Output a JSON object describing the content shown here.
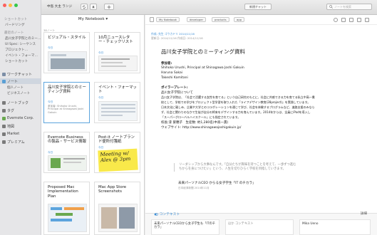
{
  "sidebar": {
    "shortcuts_title": "ショートカット",
    "shortcut_item": "バードリング",
    "recent_title": "最近のノート",
    "recent_items": [
      "品川女子学院とのミー…",
      "UI Spec: シーケンス",
      "プロジェクト…",
      "イベント・フォーマ…",
      "ショートカット"
    ],
    "nav": [
      {
        "label": "ワークチャット",
        "color": "#7c8ea6"
      },
      {
        "label": "ノート",
        "color": "#5a9fd4"
      },
      {
        "label": "ノートブック",
        "color": "#7a7a7a"
      },
      {
        "label": "タグ",
        "color": "#7a7a7a"
      },
      {
        "label": "Evernote Corp.",
        "color": "#6aa84f"
      },
      {
        "label": "地図",
        "color": "#7a7a7a"
      },
      {
        "label": "Market",
        "color": "#7a7a7a"
      },
      {
        "label": "プレミアム",
        "color": "#7a7a7a"
      }
    ],
    "note_sub": [
      "個人ノート",
      "ビジネスノート"
    ]
  },
  "toolbar": {
    "account": "中島 大主 ランジ",
    "new_chat": "新規チャット",
    "search_placeholder": "ノートを検索"
  },
  "notelist": {
    "title": "My Notebook",
    "subtitle": "38ノート",
    "cards": [
      {
        "title": "ビジュアル・スタイル",
        "date": "今日",
        "snippet": "プロジェクト"
      },
      {
        "title": "10月ニュースレター・チェックリスト",
        "date": "今日",
        "snippet": "ニュースレターの準備"
      },
      {
        "title": "品川女子学院とのミーティング資料",
        "date": "今日",
        "snippet": "参加者: Shihoko Urushi, Principal at Shinagawa Joshi Gakuin"
      },
      {
        "title": "イベント・フォーマット",
        "date": "今日",
        "snippet": "イベント"
      },
      {
        "title": "Evernote Businessの製品・サービス情報",
        "date": "今日",
        "snippet": "Evernote Business"
      },
      {
        "title": "Post-it ノートブランド便所付箋紙",
        "date": "今日",
        "snippet": "Meeting w/ Alex @ 3pm"
      },
      {
        "title": "Proposed Mac Implementation Plan",
        "date": "",
        "snippet": ""
      },
      {
        "title": "Mac App Store Screenshots",
        "date": "",
        "snippet": ""
      }
    ]
  },
  "editor": {
    "notebook_tag": "My Notebook",
    "tags": [
      "developer",
      "products",
      "app"
    ],
    "meta_top": "作成: 先生 ゴウカドリ 2014/11/16",
    "meta_date": "更新日: 2014/11/16    作成日: 2014/11/16",
    "title": "品川女子学院とのミーティング資料",
    "participants_label": "参加者:",
    "participants": [
      "Shihoko Urushi, Principal at Shinagawa Joshi Gakuin",
      "Haruna Sakai",
      "Takeshi Kamitani"
    ],
    "school_label": "ポイラープレート:",
    "school_lines": [
      "品川女子学院について",
      "品川女子学院は、「社会で活躍する女性を育てる」という自己研究のもとに、社会に共感できる力を育てる私立中高一貫",
      "校として、学校での学びをプロジェクト型学習を取り入れた「ライフデザイン教育(28project)」を実践しています。",
      "日本文化に親しみ、企業や大学とのコラボレーションを通じて学び、社会を体験するプログラムなど、進路支援のみなら",
      "ず、社会と関わりのなかで生徒が自分の将来をデザインする力を育んでいます。2014年からは、全員にiPadを導入し",
      "「スーパーグローバルハイスクール」にも指定されています。",
      "校長:漆 紫穂子　生徒数: 約1,280名(中高一貫)",
      "ウェブサイト: http://www.shinagawajoshigakuin.jp/"
    ],
    "quote_lines": [
      "リーダシップから大事なんです。「自分たちが興味を持つことを考えて、一歩ずつ進む",
      "ちからを身につけたい」という、人生を切りひらく学校を目指していきます。"
    ],
    "quote_source": "未来パーソナルCEO からる女子学生「IT のチカラ」",
    "quote_sub": "日本経済新聞 2014年11月",
    "context_label": "コンテキスト",
    "context_more": "詳細",
    "context_cards": [
      "未来パーソナルCEOから女子学生も「ITのチカラ」",
      "ほか コンテキスト",
      "Mika Ueno"
    ]
  }
}
